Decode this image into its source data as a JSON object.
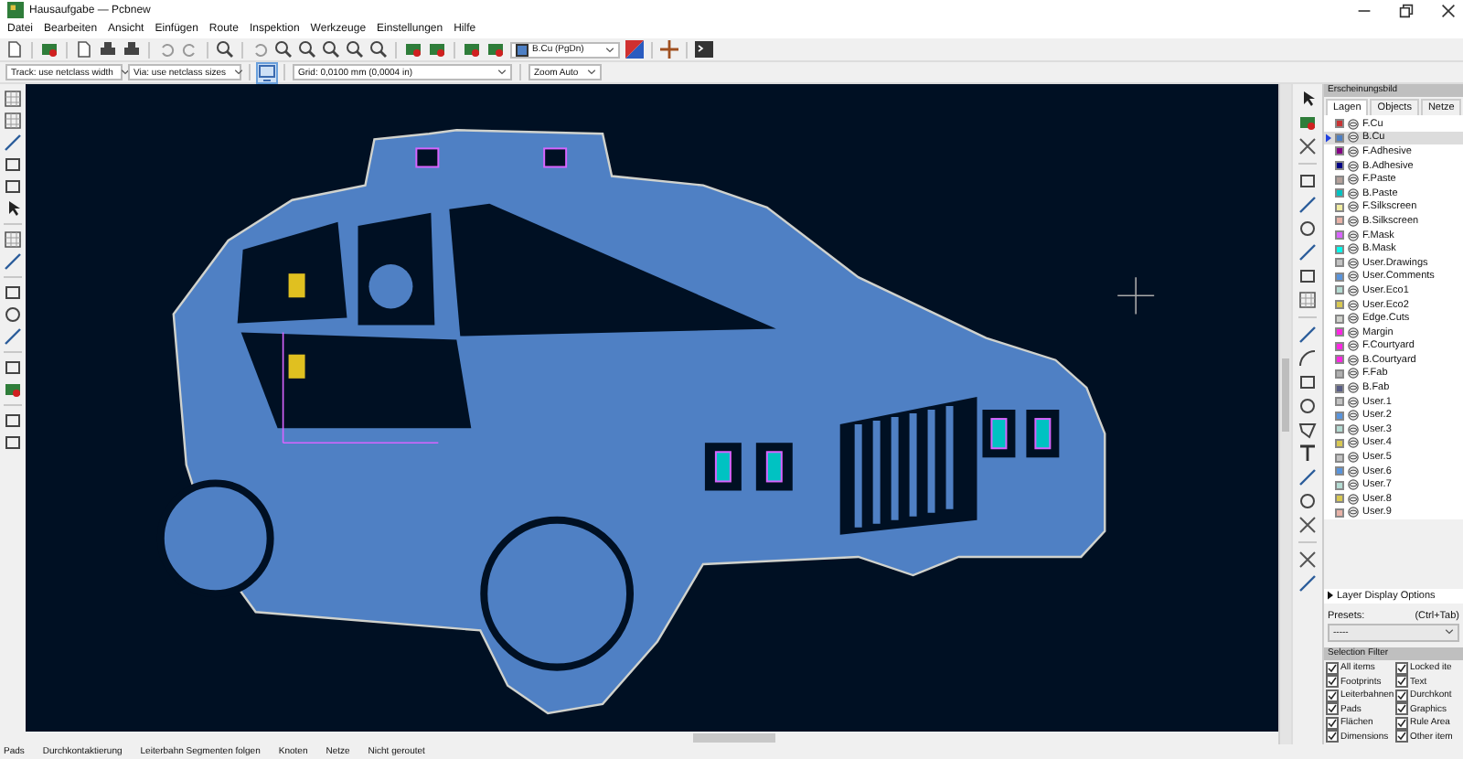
{
  "window": {
    "title": "Hausaufgabe — Pcbnew"
  },
  "menu": [
    "Datei",
    "Bearbeiten",
    "Ansicht",
    "Einfügen",
    "Route",
    "Inspektion",
    "Werkzeuge",
    "Einstellungen",
    "Hilfe"
  ],
  "toolbar": {
    "layer_select": "B.Cu (PgDn)"
  },
  "options_bar": {
    "track": "Track: use netclass width",
    "via": "Via: use netclass sizes",
    "grid": "Grid: 0,0100 mm (0,0004 in)",
    "zoom": "Zoom Auto"
  },
  "appearance": {
    "title": "Erscheinungsbild",
    "tabs": [
      {
        "label": "Lagen",
        "selected": true
      },
      {
        "label": "Objects",
        "selected": false
      },
      {
        "label": "Netze",
        "selected": false
      }
    ],
    "layers": [
      {
        "name": "F.Cu",
        "color": "#c83434",
        "selected": false
      },
      {
        "name": "B.Cu",
        "color": "#4d7fc4",
        "selected": true
      },
      {
        "name": "F.Adhesive",
        "color": "#840084",
        "selected": false
      },
      {
        "name": "B.Adhesive",
        "color": "#000084",
        "selected": false
      },
      {
        "name": "F.Paste",
        "color": "#b4a09a",
        "selected": false
      },
      {
        "name": "B.Paste",
        "color": "#00c2c2",
        "selected": false
      },
      {
        "name": "F.Silkscreen",
        "color": "#f2eda1",
        "selected": false
      },
      {
        "name": "B.Silkscreen",
        "color": "#e8b2a7",
        "selected": false
      },
      {
        "name": "F.Mask",
        "color": "#d864ff",
        "selected": false
      },
      {
        "name": "B.Mask",
        "color": "#02ffee",
        "selected": false
      },
      {
        "name": "User.Drawings",
        "color": "#c2c2c2",
        "selected": false
      },
      {
        "name": "User.Comments",
        "color": "#5994dc",
        "selected": false
      },
      {
        "name": "User.Eco1",
        "color": "#b4dbd2",
        "selected": false
      },
      {
        "name": "User.Eco2",
        "color": "#d8c852",
        "selected": false
      },
      {
        "name": "Edge.Cuts",
        "color": "#d0d2cd",
        "selected": false
      },
      {
        "name": "Margin",
        "color": "#ff26e2",
        "selected": false
      },
      {
        "name": "F.Courtyard",
        "color": "#ff26e2",
        "selected": false
      },
      {
        "name": "B.Courtyard",
        "color": "#ff26e2",
        "selected": false
      },
      {
        "name": "F.Fab",
        "color": "#afafaf",
        "selected": false
      },
      {
        "name": "B.Fab",
        "color": "#585d84",
        "selected": false
      },
      {
        "name": "User.1",
        "color": "#c2c2c2",
        "selected": false
      },
      {
        "name": "User.2",
        "color": "#5994dc",
        "selected": false
      },
      {
        "name": "User.3",
        "color": "#b4dbd2",
        "selected": false
      },
      {
        "name": "User.4",
        "color": "#d8c852",
        "selected": false
      },
      {
        "name": "User.5",
        "color": "#c2c2c2",
        "selected": false
      },
      {
        "name": "User.6",
        "color": "#5994dc",
        "selected": false
      },
      {
        "name": "User.7",
        "color": "#b4dbd2",
        "selected": false
      },
      {
        "name": "User.8",
        "color": "#d8c852",
        "selected": false
      },
      {
        "name": "User.9",
        "color": "#e8b2a7",
        "selected": false
      }
    ],
    "layer_display_options": "Layer Display Options",
    "presets_label": "Presets:",
    "presets_shortcut": "(Ctrl+Tab)",
    "presets_value": "-----"
  },
  "selection_filter": {
    "title": "Selection Filter",
    "items": [
      {
        "label": "All items",
        "checked": true
      },
      {
        "label": "Locked ite",
        "checked": true
      },
      {
        "label": "Footprints",
        "checked": true
      },
      {
        "label": "Text",
        "checked": true
      },
      {
        "label": "Leiterbahnen",
        "checked": true
      },
      {
        "label": "Durchkont",
        "checked": true
      },
      {
        "label": "Pads",
        "checked": true
      },
      {
        "label": "Graphics",
        "checked": true
      },
      {
        "label": "Flächen",
        "checked": true
      },
      {
        "label": "Rule Area",
        "checked": true
      },
      {
        "label": "Dimensions",
        "checked": true
      },
      {
        "label": "Other item",
        "checked": true
      }
    ]
  },
  "status_bar": [
    "Pads",
    "Durchkontaktierung",
    "Leiterbahn Segmenten folgen",
    "Knoten",
    "Netze",
    "Nicht geroutet"
  ]
}
